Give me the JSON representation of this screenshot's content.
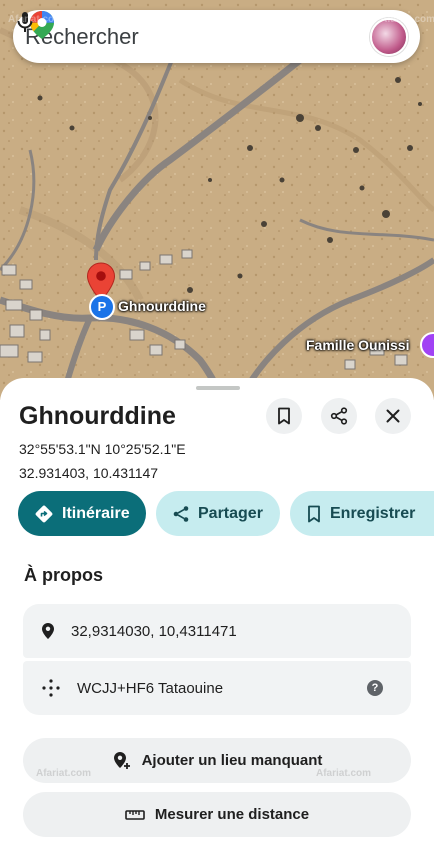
{
  "search": {
    "placeholder": "Rechercher"
  },
  "map": {
    "place_label": "Ghnourddine",
    "poi_label": "Famille Ounissi"
  },
  "place": {
    "name": "Ghnourddine",
    "dms": "32°55'53.1\"N 10°25'52.1\"E",
    "decimal": "32.931403, 10.431147"
  },
  "actions": {
    "directions": "Itinéraire",
    "share": "Partager",
    "save": "Enregistrer"
  },
  "about": {
    "title": "À propos",
    "coordinates": "32,9314030, 10,4311471",
    "plus_code": "WCJJ+HF6 Tataouine"
  },
  "buttons": {
    "add_place": "Ajouter un lieu manquant",
    "measure": "Mesurer une distance"
  },
  "watermark": [
    "Afariat.com",
    "Afariat.com",
    "Afariat.com",
    "Afariat.com"
  ],
  "colors": {
    "accent": "#0b6e79",
    "accent_soft": "#c6ecef",
    "pin": "#ea4335"
  }
}
